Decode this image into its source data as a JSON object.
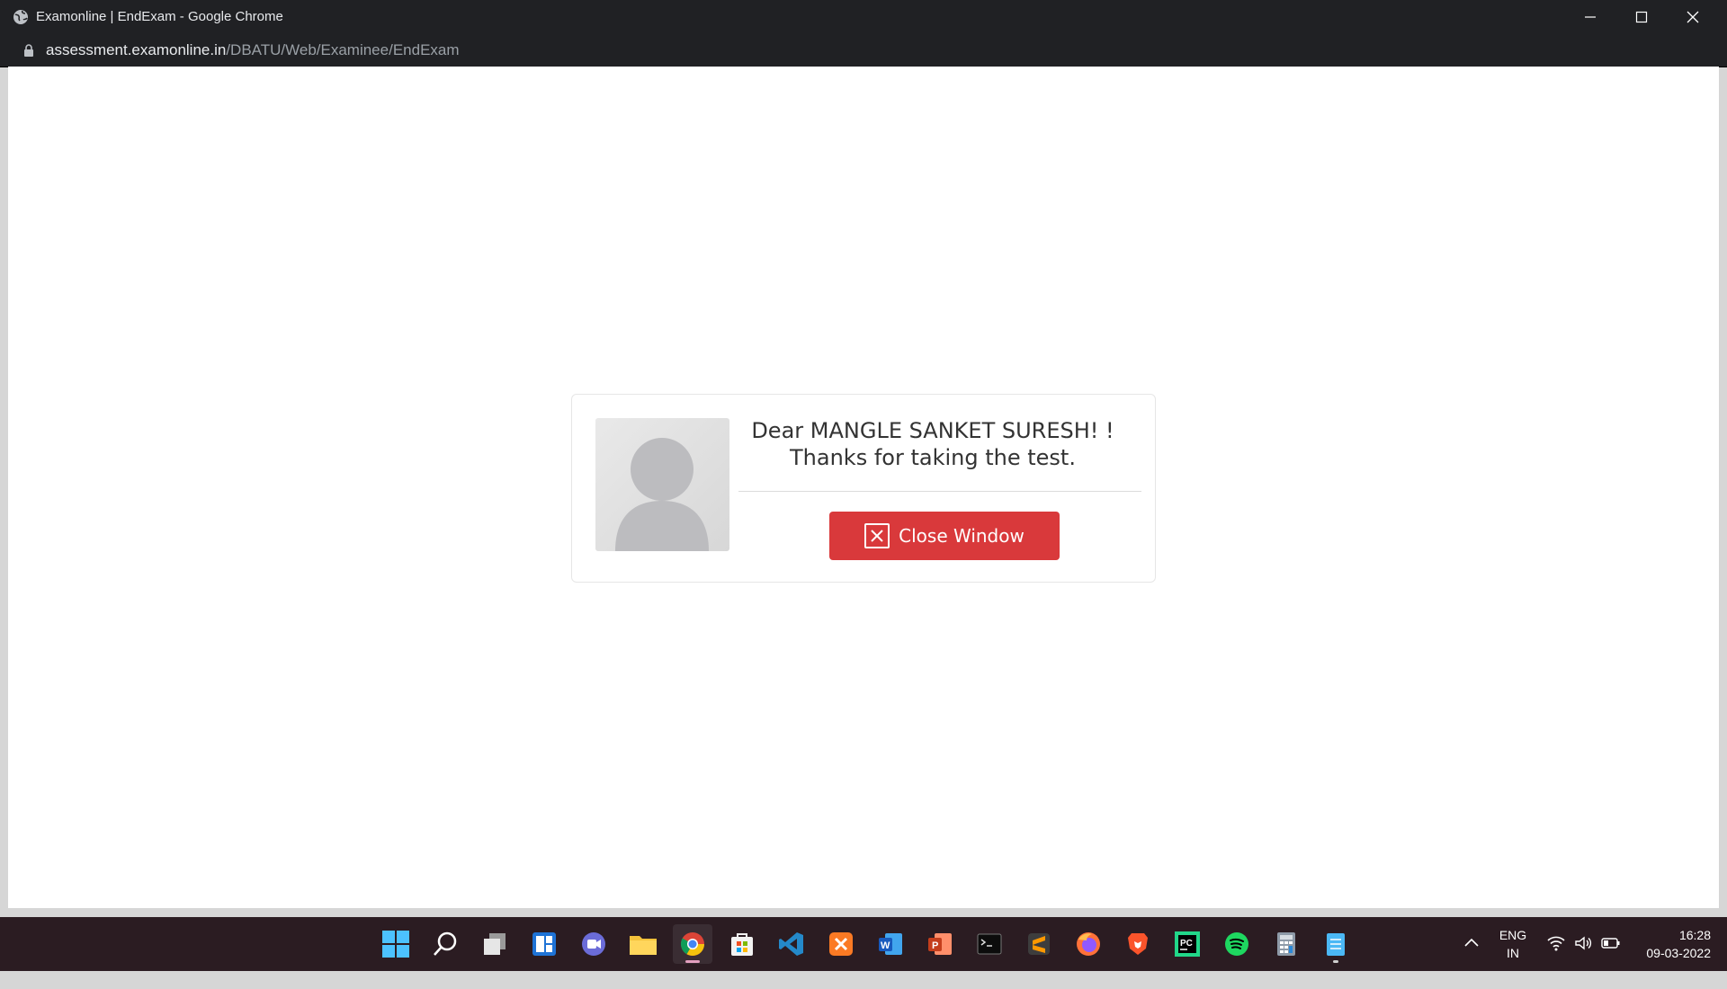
{
  "window": {
    "title": "Examonline | EndExam - Google Chrome",
    "url_domain": "assessment.examonline.in",
    "url_path": "/DBATU/Web/Examinee/EndExam"
  },
  "card": {
    "greeting": "Dear MANGLE SANKET SURESH! !",
    "message": "Thanks for taking the test.",
    "close_label": "Close Window"
  },
  "taskbar": {
    "apps": [
      "start-icon",
      "search-icon",
      "task-view-icon",
      "widgets-icon",
      "teams-chat-icon",
      "file-explorer-icon",
      "chrome-icon",
      "microsoft-store-icon",
      "vscode-icon",
      "xampp-icon",
      "word-icon",
      "powerpoint-icon",
      "terminal-icon",
      "sublime-text-icon",
      "firefox-icon",
      "brave-icon",
      "pycharm-icon",
      "spotify-icon",
      "calculator-icon",
      "notepad-icon"
    ],
    "lang_line1": "ENG",
    "lang_line2": "IN",
    "time": "16:28",
    "date": "09-03-2022"
  },
  "colors": {
    "accent_button": "#d9393b",
    "titlebar": "#202124",
    "taskbar": "#2b1c22"
  }
}
